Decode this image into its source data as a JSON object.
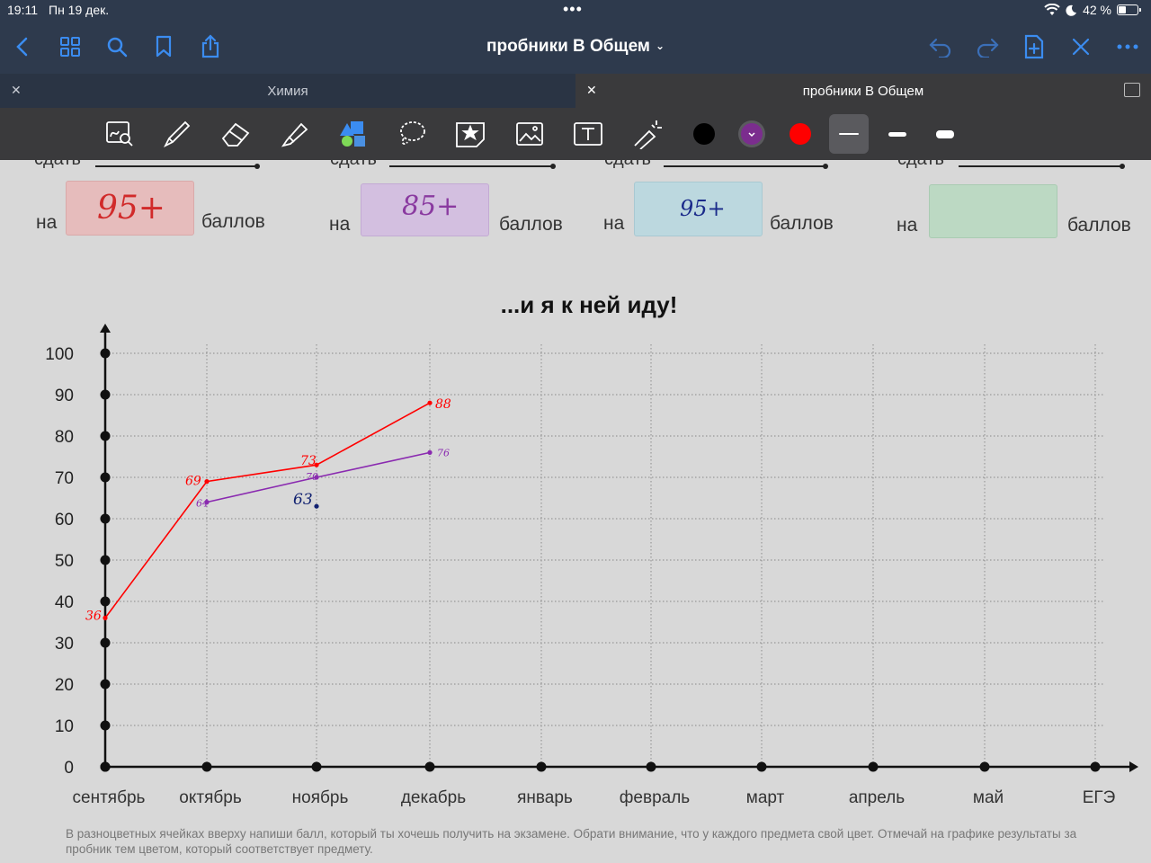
{
  "status": {
    "time": "19:11",
    "date": "Пн 19 дек.",
    "battery": "42 %",
    "battery_level": 0.42
  },
  "nav": {
    "title": "пробники В Общем"
  },
  "tabs": [
    {
      "label": "Химия",
      "active": false
    },
    {
      "label": "пробники В Общем",
      "active": true
    }
  ],
  "colors": {
    "black": "#000000",
    "purple": "#7b2d8e",
    "red": "#ff0000",
    "selected": "purple"
  },
  "targets": {
    "prefix": "на",
    "suffix": "баллов",
    "cut_word": "сдать",
    "items": [
      {
        "value": "95+",
        "color": "#d12a2a"
      },
      {
        "value": "85+",
        "color": "#8a3aa0"
      },
      {
        "value": "95+",
        "color": "#1a2a8a"
      },
      {
        "value": "",
        "color": ""
      }
    ]
  },
  "chart_data": {
    "type": "line",
    "title": "...и я к ней иду!",
    "categories": [
      "сентябрь",
      "октябрь",
      "ноябрь",
      "декабрь",
      "январь",
      "февраль",
      "март",
      "апрель",
      "май",
      "ЕГЭ"
    ],
    "ylim": [
      0,
      100
    ],
    "yticks": [
      0,
      10,
      20,
      30,
      40,
      50,
      60,
      70,
      80,
      90,
      100
    ],
    "grid": true,
    "series": [
      {
        "color": "#ff0000",
        "values": [
          36,
          69,
          73,
          88
        ],
        "labels": [
          "36",
          "69",
          "73",
          "88"
        ]
      },
      {
        "color": "#8a2ab0",
        "values": [
          null,
          64,
          70,
          76
        ],
        "labels": [
          "",
          "64",
          "70",
          "76"
        ]
      },
      {
        "color": "#102070",
        "values": [
          null,
          null,
          63,
          null
        ],
        "labels": [
          "",
          "",
          "63",
          ""
        ]
      }
    ]
  },
  "footnote": "В разноцветных ячейках вверху напиши балл, который ты хочешь получить на экзамене. Обрати внимание, что у каждого предмета свой цвет. Отмечай на графике результаты за пробник тем цветом, который соответствует предмету."
}
